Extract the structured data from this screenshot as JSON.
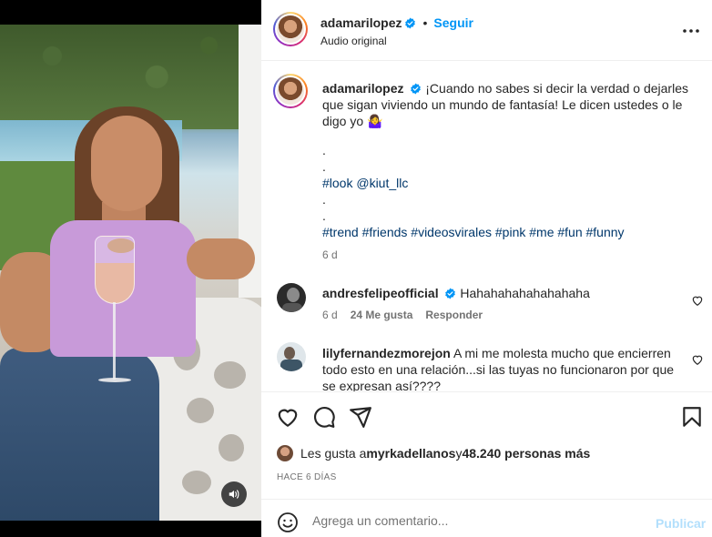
{
  "header": {
    "username": "adamarilopez",
    "separator": "•",
    "follow_label": "Seguir",
    "subtitle": "Audio original"
  },
  "caption": {
    "username": "adamarilopez",
    "text": "¡Cuando no sabes si decir la verdad o dejarles que sigan viviendo un mundo de fantasía! Le dicen ustedes o le digo yo 🤷‍♀️",
    "dot1": ".",
    "dot2": ".",
    "mention_line": "#look @kiut_llc",
    "dot3": ".",
    "dot4": ".",
    "hashtags": "#trend #friends #videosvirales #pink #me #fun #funny",
    "time": "6 d"
  },
  "comments": [
    {
      "username": "andresfelipeofficial",
      "text": "Hahahahahahahahaha",
      "time": "6 d",
      "likes": "24 Me gusta",
      "reply": "Responder"
    },
    {
      "username": "lilyfernandezmorejon",
      "text": "A mi me molesta mucho que encierren todo esto en una relación...si las tuyas no funcionaron por que se expresan así????"
    }
  ],
  "likes": {
    "prefix": "Les gusta a ",
    "user": "myrkadellanos",
    "middle": " y ",
    "count": "48.240 personas más"
  },
  "date": "HACE 6 DÍAS",
  "add_comment": {
    "placeholder": "Agrega un comentario...",
    "publish_label": "Publicar"
  },
  "colors": {
    "accent": "#0095f6",
    "publish_disabled": "#b2dffc",
    "link": "#00376b",
    "muted": "#737373",
    "text": "#262626"
  },
  "icons": {
    "more": "more-options-icon",
    "verified": "verified-badge-icon",
    "like": "heart-icon",
    "comment": "comment-icon",
    "share": "share-icon",
    "save": "bookmark-icon",
    "emoji": "emoji-icon",
    "sound": "speaker-icon"
  }
}
